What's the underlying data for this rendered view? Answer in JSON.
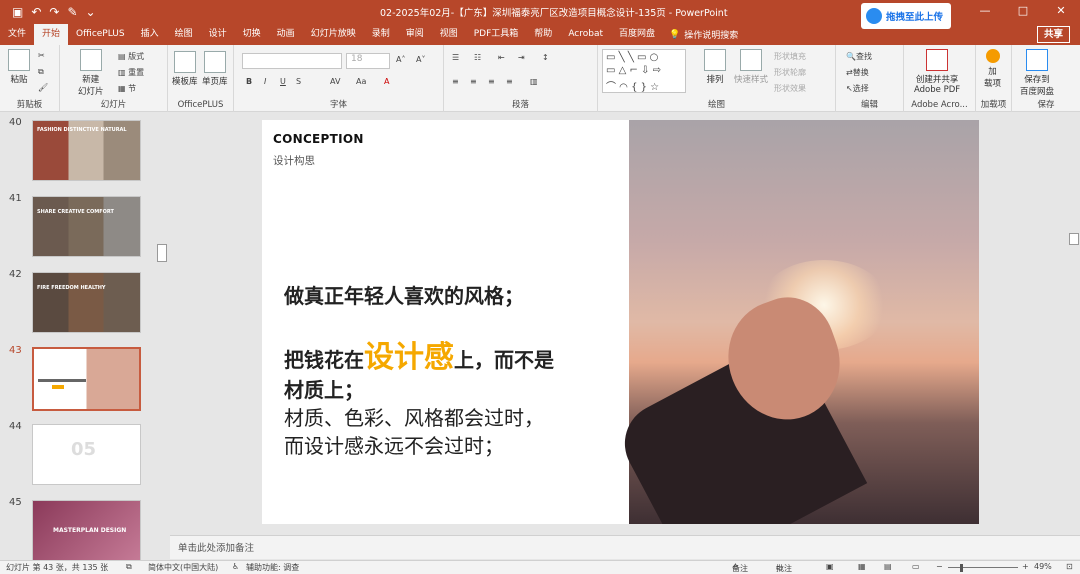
{
  "titlebar": {
    "title": "02-2025年02月-【广东】深圳福泰亮厂区改造项目概念设计-135页  -  PowerPoint",
    "baidu_upload": "拖拽至此上传",
    "min": "—",
    "restore": "□",
    "close": "✕"
  },
  "tabs": [
    "文件",
    "开始",
    "OfficePLUS",
    "插入",
    "绘图",
    "设计",
    "切换",
    "动画",
    "幻灯片放映",
    "录制",
    "审阅",
    "视图",
    "PDF工具箱",
    "帮助",
    "Acrobat",
    "百度网盘"
  ],
  "active_tab": "开始",
  "tell_me": "操作说明搜索",
  "share": "共享",
  "ribbon": {
    "clipboard": {
      "paste": "粘贴",
      "label": "剪贴板"
    },
    "slides": {
      "new_slide": "新建\n幻灯片",
      "layout": "版式",
      "reset": "重置",
      "section": "节",
      "label": "幻灯片"
    },
    "officeplus": {
      "template": "模板库",
      "single": "单页库",
      "label": "OfficePLUS"
    },
    "font": {
      "size": "18",
      "bold": "B",
      "italic": "I",
      "underline": "U",
      "strike": "S",
      "spacing": "AV",
      "case": "Aa",
      "color": "A",
      "label": "字体"
    },
    "paragraph": {
      "label": "段落"
    },
    "drawing": {
      "arrange": "排列",
      "quick_styles": "快速样式",
      "fill": "形状填充",
      "outline": "形状轮廓",
      "effect": "形状效果",
      "label": "绘图"
    },
    "editing": {
      "find": "查找",
      "replace": "替换",
      "select": "选择",
      "label": "编辑"
    },
    "adobe": {
      "create": "创建并共享\nAdobe PDF",
      "label": "Adobe Acro..."
    },
    "addins": {
      "addin": "加\n载项",
      "label": "加载项"
    },
    "save": {
      "save_baidu": "保存到\n百度网盘",
      "label": "保存"
    }
  },
  "thumbnails": [
    {
      "num": "40",
      "color": "#8a5a4a",
      "title": "FASHION  DISTINCTIVE  NATURAL"
    },
    {
      "num": "41",
      "color": "#5a4b42",
      "title": "SHARE  CREATIVE  COMFORT"
    },
    {
      "num": "42",
      "color": "#4a3c34",
      "title": "FIRE  FREEDOM  HEALTHY"
    },
    {
      "num": "43",
      "color": "#ffffff",
      "title": "",
      "selected": true
    },
    {
      "num": "44",
      "color": "#ffffff",
      "title": "05"
    },
    {
      "num": "45",
      "color": "#a85a78",
      "title": "MASTERPLAN DESIGN"
    }
  ],
  "slide": {
    "heading": "CONCEPTION",
    "subheading": "设计构思",
    "line1": "做真正年轻人喜欢的风格；",
    "line2_a": "把钱花在",
    "line2_hl": "设计感",
    "line2_b": "上，而不是",
    "line3": "材质上；",
    "line4": "材质、色彩、风格都会过时，",
    "line5": "而设计感永远不会过时；"
  },
  "notes_placeholder": "单击此处添加备注",
  "status": {
    "slide_info": "幻灯片 第 43 张，共 135 张",
    "language": "简体中文(中国大陆)",
    "accessibility": "辅助功能: 调查",
    "notes": "备注",
    "comments": "批注",
    "zoom": "49%"
  }
}
